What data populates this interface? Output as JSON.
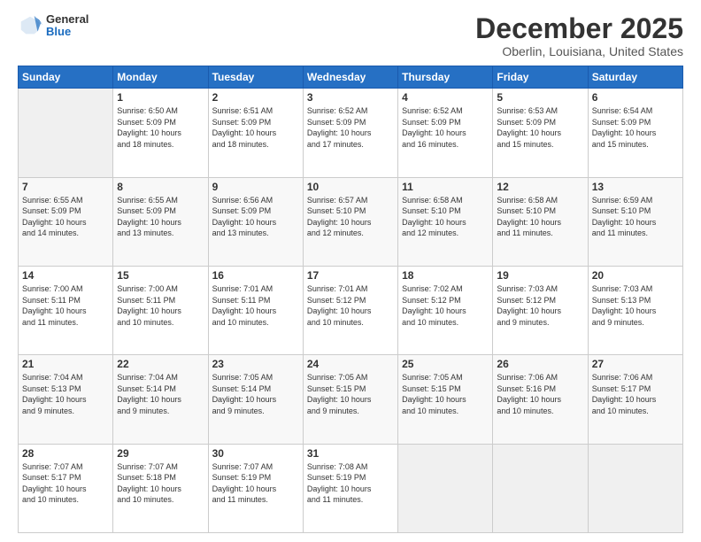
{
  "header": {
    "logo": {
      "general": "General",
      "blue": "Blue"
    },
    "title": "December 2025",
    "subtitle": "Oberlin, Louisiana, United States"
  },
  "days_of_week": [
    "Sunday",
    "Monday",
    "Tuesday",
    "Wednesday",
    "Thursday",
    "Friday",
    "Saturday"
  ],
  "weeks": [
    [
      {
        "num": "",
        "info": ""
      },
      {
        "num": "1",
        "info": "Sunrise: 6:50 AM\nSunset: 5:09 PM\nDaylight: 10 hours\nand 18 minutes."
      },
      {
        "num": "2",
        "info": "Sunrise: 6:51 AM\nSunset: 5:09 PM\nDaylight: 10 hours\nand 18 minutes."
      },
      {
        "num": "3",
        "info": "Sunrise: 6:52 AM\nSunset: 5:09 PM\nDaylight: 10 hours\nand 17 minutes."
      },
      {
        "num": "4",
        "info": "Sunrise: 6:52 AM\nSunset: 5:09 PM\nDaylight: 10 hours\nand 16 minutes."
      },
      {
        "num": "5",
        "info": "Sunrise: 6:53 AM\nSunset: 5:09 PM\nDaylight: 10 hours\nand 15 minutes."
      },
      {
        "num": "6",
        "info": "Sunrise: 6:54 AM\nSunset: 5:09 PM\nDaylight: 10 hours\nand 15 minutes."
      }
    ],
    [
      {
        "num": "7",
        "info": "Sunrise: 6:55 AM\nSunset: 5:09 PM\nDaylight: 10 hours\nand 14 minutes."
      },
      {
        "num": "8",
        "info": "Sunrise: 6:55 AM\nSunset: 5:09 PM\nDaylight: 10 hours\nand 13 minutes."
      },
      {
        "num": "9",
        "info": "Sunrise: 6:56 AM\nSunset: 5:09 PM\nDaylight: 10 hours\nand 13 minutes."
      },
      {
        "num": "10",
        "info": "Sunrise: 6:57 AM\nSunset: 5:10 PM\nDaylight: 10 hours\nand 12 minutes."
      },
      {
        "num": "11",
        "info": "Sunrise: 6:58 AM\nSunset: 5:10 PM\nDaylight: 10 hours\nand 12 minutes."
      },
      {
        "num": "12",
        "info": "Sunrise: 6:58 AM\nSunset: 5:10 PM\nDaylight: 10 hours\nand 11 minutes."
      },
      {
        "num": "13",
        "info": "Sunrise: 6:59 AM\nSunset: 5:10 PM\nDaylight: 10 hours\nand 11 minutes."
      }
    ],
    [
      {
        "num": "14",
        "info": "Sunrise: 7:00 AM\nSunset: 5:11 PM\nDaylight: 10 hours\nand 11 minutes."
      },
      {
        "num": "15",
        "info": "Sunrise: 7:00 AM\nSunset: 5:11 PM\nDaylight: 10 hours\nand 10 minutes."
      },
      {
        "num": "16",
        "info": "Sunrise: 7:01 AM\nSunset: 5:11 PM\nDaylight: 10 hours\nand 10 minutes."
      },
      {
        "num": "17",
        "info": "Sunrise: 7:01 AM\nSunset: 5:12 PM\nDaylight: 10 hours\nand 10 minutes."
      },
      {
        "num": "18",
        "info": "Sunrise: 7:02 AM\nSunset: 5:12 PM\nDaylight: 10 hours\nand 10 minutes."
      },
      {
        "num": "19",
        "info": "Sunrise: 7:03 AM\nSunset: 5:12 PM\nDaylight: 10 hours\nand 9 minutes."
      },
      {
        "num": "20",
        "info": "Sunrise: 7:03 AM\nSunset: 5:13 PM\nDaylight: 10 hours\nand 9 minutes."
      }
    ],
    [
      {
        "num": "21",
        "info": "Sunrise: 7:04 AM\nSunset: 5:13 PM\nDaylight: 10 hours\nand 9 minutes."
      },
      {
        "num": "22",
        "info": "Sunrise: 7:04 AM\nSunset: 5:14 PM\nDaylight: 10 hours\nand 9 minutes."
      },
      {
        "num": "23",
        "info": "Sunrise: 7:05 AM\nSunset: 5:14 PM\nDaylight: 10 hours\nand 9 minutes."
      },
      {
        "num": "24",
        "info": "Sunrise: 7:05 AM\nSunset: 5:15 PM\nDaylight: 10 hours\nand 9 minutes."
      },
      {
        "num": "25",
        "info": "Sunrise: 7:05 AM\nSunset: 5:15 PM\nDaylight: 10 hours\nand 10 minutes."
      },
      {
        "num": "26",
        "info": "Sunrise: 7:06 AM\nSunset: 5:16 PM\nDaylight: 10 hours\nand 10 minutes."
      },
      {
        "num": "27",
        "info": "Sunrise: 7:06 AM\nSunset: 5:17 PM\nDaylight: 10 hours\nand 10 minutes."
      }
    ],
    [
      {
        "num": "28",
        "info": "Sunrise: 7:07 AM\nSunset: 5:17 PM\nDaylight: 10 hours\nand 10 minutes."
      },
      {
        "num": "29",
        "info": "Sunrise: 7:07 AM\nSunset: 5:18 PM\nDaylight: 10 hours\nand 10 minutes."
      },
      {
        "num": "30",
        "info": "Sunrise: 7:07 AM\nSunset: 5:19 PM\nDaylight: 10 hours\nand 11 minutes."
      },
      {
        "num": "31",
        "info": "Sunrise: 7:08 AM\nSunset: 5:19 PM\nDaylight: 10 hours\nand 11 minutes."
      },
      {
        "num": "",
        "info": ""
      },
      {
        "num": "",
        "info": ""
      },
      {
        "num": "",
        "info": ""
      }
    ]
  ]
}
